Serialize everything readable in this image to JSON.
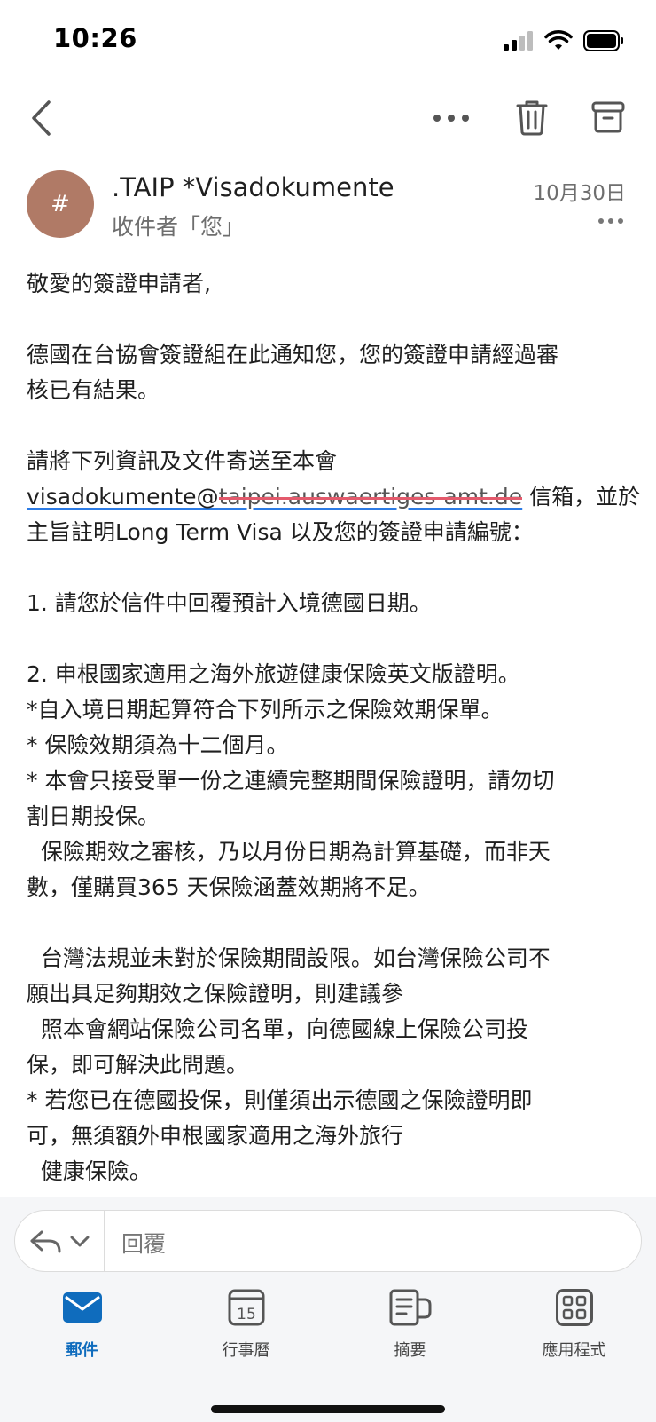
{
  "status": {
    "time": "10:26"
  },
  "message": {
    "avatar_text": "#",
    "sender": ".TAIP *Visadokumente",
    "recipient": "收件者「您」",
    "date": "10月30日"
  },
  "body": {
    "l1": "敬愛的簽證申請者,",
    "l2": "德國在台協會簽證組在此通知您，您的簽證申請經過審",
    "l3": "核已有結果。",
    "l4": "請將下列資訊及文件寄送至本會",
    "email_user": "visadokumente@",
    "email_domain": "taipei.auswaertiges-amt.de",
    "l5_suffix": " 信箱，並於",
    "l6": "主旨註明Long Term Visa 以及您的簽證申請編號：",
    "l7": "1. 請您於信件中回覆預計入境德國日期。",
    "l8": "2. 申根國家適用之海外旅遊健康保險英文版證明。",
    "l9": "*自入境日期起算符合下列所示之保險效期保單。",
    "l10": "* 保險效期須為十二個月。",
    "l11": "* 本會只接受單一份之連續完整期間保險證明，請勿切",
    "l12": "割日期投保。",
    "l13": "  保險期效之審核，乃以月份日期為計算基礎，而非天",
    "l14": "數，僅購買365 天保險涵蓋效期將不足。",
    "l15": "  台灣法規並未對於保險期間設限。如台灣保險公司不",
    "l16": "願出具足夠期效之保險證明，則建議參",
    "l17": "  照本會網站保險公司名單，向德國線上保險公司投",
    "l18": "保，即可解決此問題。",
    "l19": "* 若您已在德國投保，則僅須出示德國之保險證明即",
    "l20": "可，無須額外申根國家適用之海外旅行",
    "l21": "  健康保險。"
  },
  "reply": {
    "placeholder": "回覆"
  },
  "tabs": [
    {
      "label": "郵件",
      "icon": "mail-icon",
      "active": true
    },
    {
      "label": "行事曆",
      "icon": "calendar-icon",
      "day": "15"
    },
    {
      "label": "摘要",
      "icon": "digest-icon"
    },
    {
      "label": "應用程式",
      "icon": "apps-grid-icon"
    }
  ],
  "colors": {
    "accent": "#0f6cbd",
    "avatar": "#b07a66"
  }
}
